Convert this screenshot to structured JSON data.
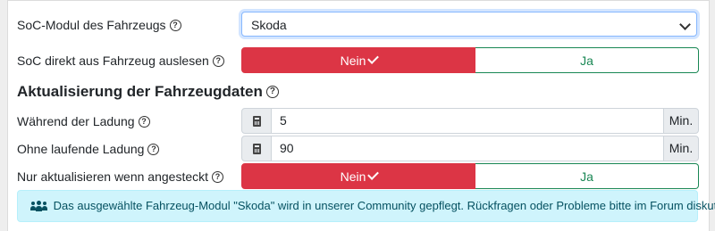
{
  "soc_module": {
    "label": "SoC-Modul des Fahrzeugs",
    "selected": "Skoda"
  },
  "read_direct": {
    "label": "SoC direkt aus Fahrzeug auslesen",
    "no": "Nein",
    "yes": "Ja",
    "value": "Nein"
  },
  "update_section": {
    "heading": "Aktualisierung der Fahrzeugdaten"
  },
  "during_charge": {
    "label": "Während der Ladung",
    "value": "5",
    "unit": "Min."
  },
  "without_charge": {
    "label": "Ohne laufende Ladung",
    "value": "90",
    "unit": "Min."
  },
  "only_plugged": {
    "label": "Nur aktualisieren wenn angesteckt",
    "no": "Nein",
    "yes": "Ja",
    "value": "Nein"
  },
  "info_alert": {
    "text": "Das ausgewählte Fahrzeug-Modul \"Skoda\" wird in unserer Community gepflegt. Rückfragen oder Probleme bitte im Forum diskutieren."
  },
  "icons": {
    "help": "question-circle-icon",
    "calculator": "calculator-icon",
    "users": "users-icon",
    "check": "check-icon",
    "chevron": "chevron-down-icon"
  },
  "colors": {
    "danger": "#dc3545",
    "success": "#198754",
    "info_bg": "#cff4fc",
    "info_text": "#055160",
    "focus": "#86b7fe"
  }
}
